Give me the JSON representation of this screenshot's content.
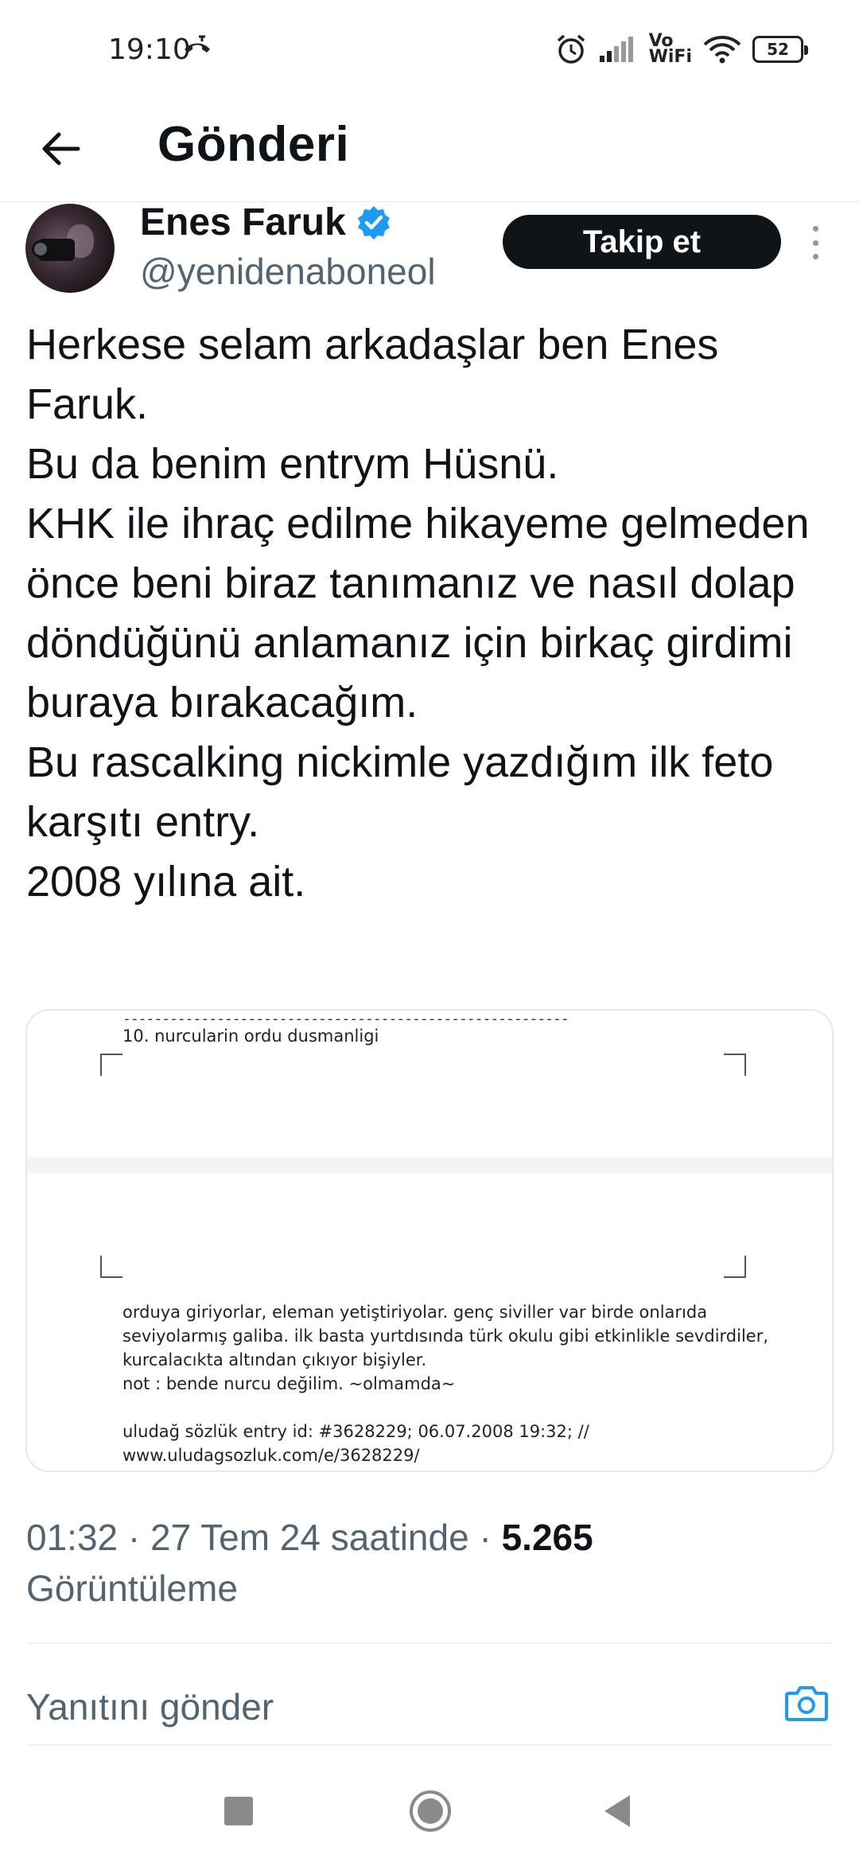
{
  "status_bar": {
    "time": "19:10",
    "network": "Vo\nWiFi",
    "battery": "52",
    "icons": [
      "phone-call-icon",
      "alarm-icon",
      "signal-icon",
      "wifi-icon",
      "battery-icon"
    ]
  },
  "header": {
    "title": "Gönderi",
    "back_icon": "arrow-left-icon"
  },
  "post": {
    "author": {
      "name": "Enes Faruk",
      "handle": "@yenidenaboneol",
      "verified": true
    },
    "follow_label": "Takip et",
    "text": "Herkese selam arkadaşlar ben Enes Faruk.\nBu da benim entrym Hüsnü.\nKHK ile ihraç edilme hikayeme gelmeden önce beni biraz tanımanız ve nasıl dolap döndüğünü anlamanız için birkaç girdimi buraya bırakacağım.\nBu rascalking nickimle yazdığım ilk feto karşıtı entry.\n2008 yılına ait.",
    "media": {
      "dashes": "---------------------------------------------------------",
      "entry_title": "10. nurcularin ordu dusmanligi",
      "entry_body": "orduya giriyorlar, eleman yetiştiriyolar. genç siviller var birde onlarıda seviyolarmış galiba. ilk basta yurtdısında türk okulu gibi etkinlikle sevdirdiler, kurcalacıkta altından çıkıyor bişiyler.\nnot : bende nurcu değilim. ~olmamda~\n\nuludağ sözlük entry id: #3628229; 06.07.2008 19:32; //\nwww.uludagsozluk.com/e/3628229/"
    },
    "meta": {
      "time": "01:32",
      "date": "27 Tem 24 saatinde",
      "separator": " · ",
      "views_count": "5.265",
      "views_label": "Görüntüleme"
    }
  },
  "reply": {
    "placeholder": "Yanıtını gönder",
    "camera_icon": "camera-icon"
  },
  "colors": {
    "accent": "#1d9bf0",
    "text_primary": "#0f1419",
    "text_secondary": "#536471"
  }
}
